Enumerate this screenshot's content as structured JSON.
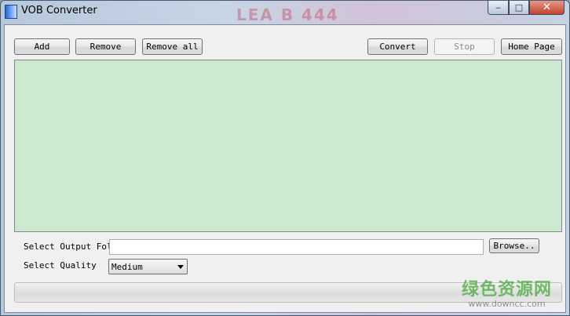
{
  "window": {
    "title": "VOB Converter",
    "deco_text": "LEA B 444"
  },
  "toolbar": {
    "add": "Add",
    "remove": "Remove",
    "remove_all": "Remove all",
    "convert": "Convert",
    "stop": "Stop",
    "home_page": "Home Page"
  },
  "output": {
    "folder_label": "Select Output Folder",
    "folder_value": "",
    "browse": "Browse.."
  },
  "quality": {
    "label": "Select Quality",
    "selected": "Medium"
  },
  "progress": {
    "value": 0
  },
  "watermark": {
    "cn": "绿色资源网",
    "url": "www.downcc.com"
  },
  "colors": {
    "list_background": "#cce8cf",
    "close_button": "#c3432c"
  }
}
